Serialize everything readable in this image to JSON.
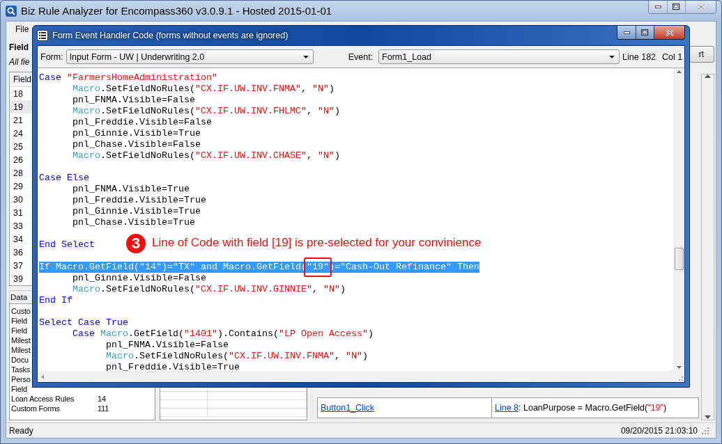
{
  "window": {
    "title": "Biz Rule Analyzer for Encompass360 v3.0.9.1 - Hosted 2015-01-01"
  },
  "menu": [
    "File"
  ],
  "field_label": "Field",
  "field_hint": "All fie",
  "field_table": {
    "columns": [
      "Field"
    ],
    "rows": [
      {
        "cell": "18",
        "selected": false
      },
      {
        "cell": "19",
        "selected": true
      },
      {
        "cell": "21",
        "selected": false
      },
      {
        "cell": "24",
        "selected": false
      },
      {
        "cell": "25",
        "selected": false
      },
      {
        "cell": "26",
        "selected": false
      },
      {
        "cell": "28",
        "selected": false
      },
      {
        "cell": "29",
        "selected": false
      },
      {
        "cell": "30",
        "selected": false
      },
      {
        "cell": "31",
        "selected": false
      },
      {
        "cell": "33",
        "selected": false
      },
      {
        "cell": "34",
        "selected": false
      },
      {
        "cell": "36",
        "selected": false
      },
      {
        "cell": "37",
        "selected": false
      },
      {
        "cell": "39",
        "selected": false
      }
    ]
  },
  "data_sources": {
    "title": "Data",
    "items": [
      {
        "label": "Custo"
      },
      {
        "label": "Field"
      },
      {
        "label": "Field"
      },
      {
        "label": "Milest"
      },
      {
        "label": "Milest"
      },
      {
        "label": "Docu"
      },
      {
        "label": "Tasks"
      },
      {
        "label": "Perso"
      },
      {
        "label": "Field"
      },
      {
        "label": "Loan Access Rules",
        "count": "14"
      },
      {
        "label": "Custom Forms",
        "count": "111"
      }
    ]
  },
  "right_button": "rt",
  "results": [
    {
      "event": "Button1_Click",
      "line_link": "Line 8",
      "code_before": ": LoanPurpose = Macro.GetField(",
      "code_value": "\"19\"",
      "code_after": ")"
    }
  ],
  "status_bar": {
    "left": "Ready",
    "right": "09/20/2015 21:03:10"
  },
  "dialog": {
    "title": "Form Event Handler Code (forms without events are ignored)",
    "form_label": "Form:",
    "form_value": "Input Form - UW | Underwriting 2.0",
    "event_label": "Event:",
    "event_value": "Form1_Load",
    "line": "Line 182",
    "col": "Col 1",
    "code": [
      {
        "kind": "code",
        "selected": false,
        "tokens": [
          {
            "kind": "keyword",
            "text": "Case"
          },
          {
            "kind": "string",
            "text": " \"FarmersHomeAdministration\""
          }
        ]
      },
      {
        "kind": "code",
        "selected": false,
        "tokens": [
          {
            "kind": "macro",
            "text": "      Macro"
          },
          {
            "kind": "plain",
            "text": ".SetFieldNoRules("
          },
          {
            "kind": "string",
            "text": "\"CX.IF.UW.INV.FNMA\""
          },
          {
            "kind": "plain",
            "text": ", "
          },
          {
            "kind": "string",
            "text": "\"N\""
          },
          {
            "kind": "plain",
            "text": ")"
          }
        ]
      },
      {
        "kind": "code",
        "selected": false,
        "tokens": [
          {
            "kind": "plain",
            "text": "      pnl_FNMA.Visible=False"
          }
        ]
      },
      {
        "kind": "code",
        "selected": false,
        "tokens": [
          {
            "kind": "macro",
            "text": "      Macro"
          },
          {
            "kind": "plain",
            "text": ".SetFieldNoRules("
          },
          {
            "kind": "string",
            "text": "\"CX.IF.UW.INV.FHLMC\""
          },
          {
            "kind": "plain",
            "text": ", "
          },
          {
            "kind": "string",
            "text": "\"N\""
          },
          {
            "kind": "plain",
            "text": ")"
          }
        ]
      },
      {
        "kind": "code",
        "selected": false,
        "tokens": [
          {
            "kind": "plain",
            "text": "      pnl_Freddie.Visible=False"
          }
        ]
      },
      {
        "kind": "code",
        "selected": false,
        "tokens": [
          {
            "kind": "plain",
            "text": "      pnl_Ginnie.Visible=True"
          }
        ]
      },
      {
        "kind": "code",
        "selected": false,
        "tokens": [
          {
            "kind": "plain",
            "text": "      pnl_Chase.Visible=False"
          }
        ]
      },
      {
        "kind": "code",
        "selected": false,
        "tokens": [
          {
            "kind": "macro",
            "text": "      Macro"
          },
          {
            "kind": "plain",
            "text": ".SetFieldNoRules("
          },
          {
            "kind": "string",
            "text": "\"CX.IF.UW.INV.CHASE\""
          },
          {
            "kind": "plain",
            "text": ", "
          },
          {
            "kind": "string",
            "text": "\"N\""
          },
          {
            "kind": "plain",
            "text": ")"
          }
        ]
      },
      {
        "kind": "blank"
      },
      {
        "kind": "code",
        "selected": false,
        "tokens": [
          {
            "kind": "keyword",
            "text": "Case Else"
          }
        ]
      },
      {
        "kind": "code",
        "selected": false,
        "tokens": [
          {
            "kind": "plain",
            "text": "      pnl_FNMA.Visible=True"
          }
        ]
      },
      {
        "kind": "code",
        "selected": false,
        "tokens": [
          {
            "kind": "plain",
            "text": "      pnl_Freddie.Visible=True"
          }
        ]
      },
      {
        "kind": "code",
        "selected": false,
        "tokens": [
          {
            "kind": "plain",
            "text": "      pnl_Ginnie.Visible=True"
          }
        ]
      },
      {
        "kind": "code",
        "selected": false,
        "tokens": [
          {
            "kind": "plain",
            "text": "      pnl_Chase.Visible=True"
          }
        ]
      },
      {
        "kind": "blank"
      },
      {
        "kind": "code",
        "selected": false,
        "tokens": [
          {
            "kind": "keyword",
            "text": "End Select"
          }
        ]
      },
      {
        "kind": "blank"
      },
      {
        "kind": "code",
        "selected": true,
        "tokens": [
          {
            "text": "If Macro.GetField(\"14\")=\"TX\" and Macro.GetField("
          },
          {
            "text": "\"19\"",
            "boxed": true
          },
          {
            "text": ")=\"Cash-Out Refinance\" Then"
          }
        ]
      },
      {
        "kind": "code",
        "selected": false,
        "tokens": [
          {
            "kind": "plain",
            "text": "      pnl_Ginnie.Visible=False"
          }
        ]
      },
      {
        "kind": "code",
        "selected": false,
        "tokens": [
          {
            "kind": "macro",
            "text": "      Macro"
          },
          {
            "kind": "plain",
            "text": ".SetFieldNoRules("
          },
          {
            "kind": "string",
            "text": "\"CX.IF.UW.INV.GINNIE\""
          },
          {
            "kind": "plain",
            "text": ", "
          },
          {
            "kind": "string",
            "text": "\"N\""
          },
          {
            "kind": "plain",
            "text": ")"
          }
        ]
      },
      {
        "kind": "code",
        "selected": false,
        "tokens": [
          {
            "kind": "keyword",
            "text": "End If"
          }
        ]
      },
      {
        "kind": "blank"
      },
      {
        "kind": "code",
        "selected": false,
        "tokens": [
          {
            "kind": "keyword",
            "text": "Select Case True"
          }
        ]
      },
      {
        "kind": "code",
        "selected": false,
        "tokens": [
          {
            "kind": "keyword",
            "text": "      Case"
          },
          {
            "kind": "macro",
            "text": " Macro"
          },
          {
            "kind": "plain",
            "text": ".GetField("
          },
          {
            "kind": "string",
            "text": "\"1401\""
          },
          {
            "kind": "plain",
            "text": ").Contains("
          },
          {
            "kind": "string",
            "text": "\"LP Open Access\""
          },
          {
            "kind": "plain",
            "text": ")"
          }
        ]
      },
      {
        "kind": "code",
        "selected": false,
        "tokens": [
          {
            "kind": "plain",
            "text": "            pnl_FNMA.Visible=False"
          }
        ]
      },
      {
        "kind": "code",
        "selected": false,
        "tokens": [
          {
            "kind": "macro",
            "text": "            Macro"
          },
          {
            "kind": "plain",
            "text": ".SetFieldNoRules("
          },
          {
            "kind": "string",
            "text": "\"CX.IF.UW.INV.FNMA\""
          },
          {
            "kind": "plain",
            "text": ", "
          },
          {
            "kind": "string",
            "text": "\"N\""
          },
          {
            "kind": "plain",
            "text": ")"
          }
        ]
      },
      {
        "kind": "code",
        "selected": false,
        "tokens": [
          {
            "kind": "plain",
            "text": "            pnl_Freddie.Visible=True"
          }
        ]
      }
    ],
    "annotation": {
      "badge": "3",
      "text": "Line of Code with field [19] is pre-selected for your convinience"
    }
  }
}
